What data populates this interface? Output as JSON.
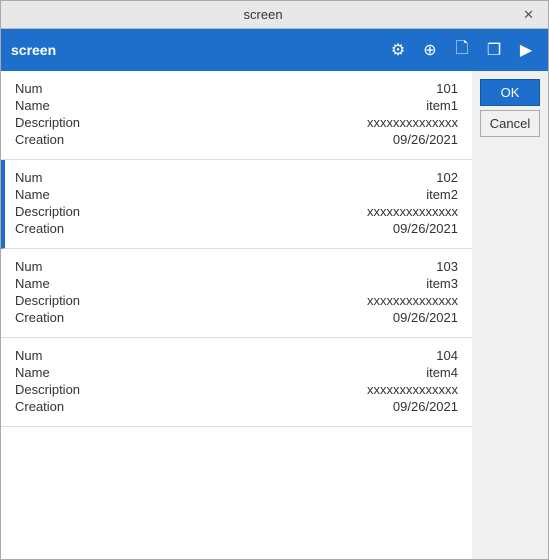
{
  "window": {
    "title": "screen",
    "close_label": "✕"
  },
  "toolbar": {
    "title": "screen",
    "icons": [
      "gear",
      "globe",
      "document",
      "copy",
      "play"
    ]
  },
  "buttons": {
    "ok_label": "OK",
    "cancel_label": "Cancel"
  },
  "items": [
    {
      "num_label": "Num",
      "num_value": "101",
      "name_label": "Name",
      "name_value": "item1",
      "desc_label": "Description",
      "desc_value": "xxxxxxxxxxxxxx",
      "creation_label": "Creation",
      "creation_value": "09/26/2021",
      "selected": false
    },
    {
      "num_label": "Num",
      "num_value": "102",
      "name_label": "Name",
      "name_value": "item2",
      "desc_label": "Description",
      "desc_value": "xxxxxxxxxxxxxx",
      "creation_label": "Creation",
      "creation_value": "09/26/2021",
      "selected": true
    },
    {
      "num_label": "Num",
      "num_value": "103",
      "name_label": "Name",
      "name_value": "item3",
      "desc_label": "Description",
      "desc_value": "xxxxxxxxxxxxxx",
      "creation_label": "Creation",
      "creation_value": "09/26/2021",
      "selected": false
    },
    {
      "num_label": "Num",
      "num_value": "104",
      "name_label": "Name",
      "name_value": "item4",
      "desc_label": "Description",
      "desc_value": "xxxxxxxxxxxxxx",
      "creation_label": "Creation",
      "creation_value": "09/26/2021",
      "selected": false
    }
  ]
}
